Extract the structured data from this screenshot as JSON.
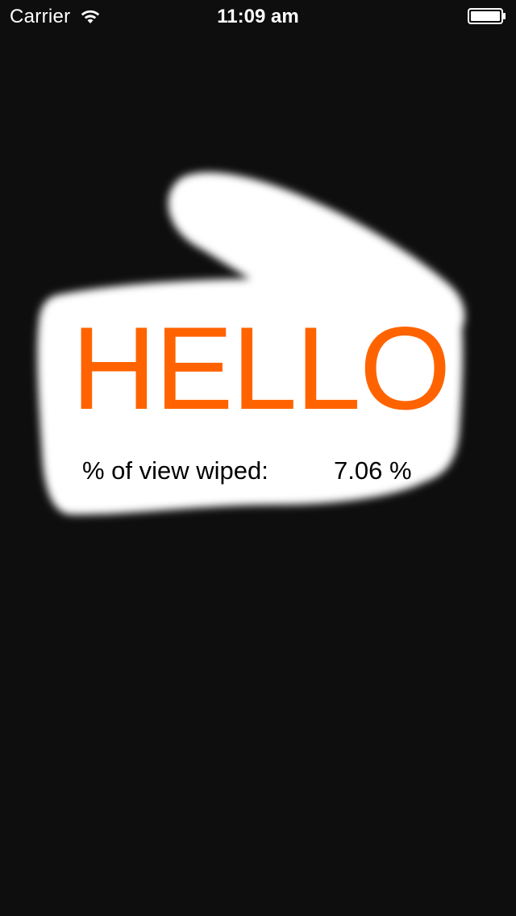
{
  "status_bar": {
    "carrier": "Carrier",
    "time": "11:09 am",
    "wifi_icon": "wifi-icon",
    "battery_icon": "battery-icon"
  },
  "main": {
    "hello_text": "HELLO",
    "wiped_label": "% of view wiped:",
    "wiped_value": "7.06 %",
    "wiped_percent": 7.06
  },
  "colors": {
    "background": "#0e0e0e",
    "wipe": "#ffffff",
    "hello": "#ff6300",
    "status_text": "#ffffff",
    "label_text": "#000000"
  }
}
